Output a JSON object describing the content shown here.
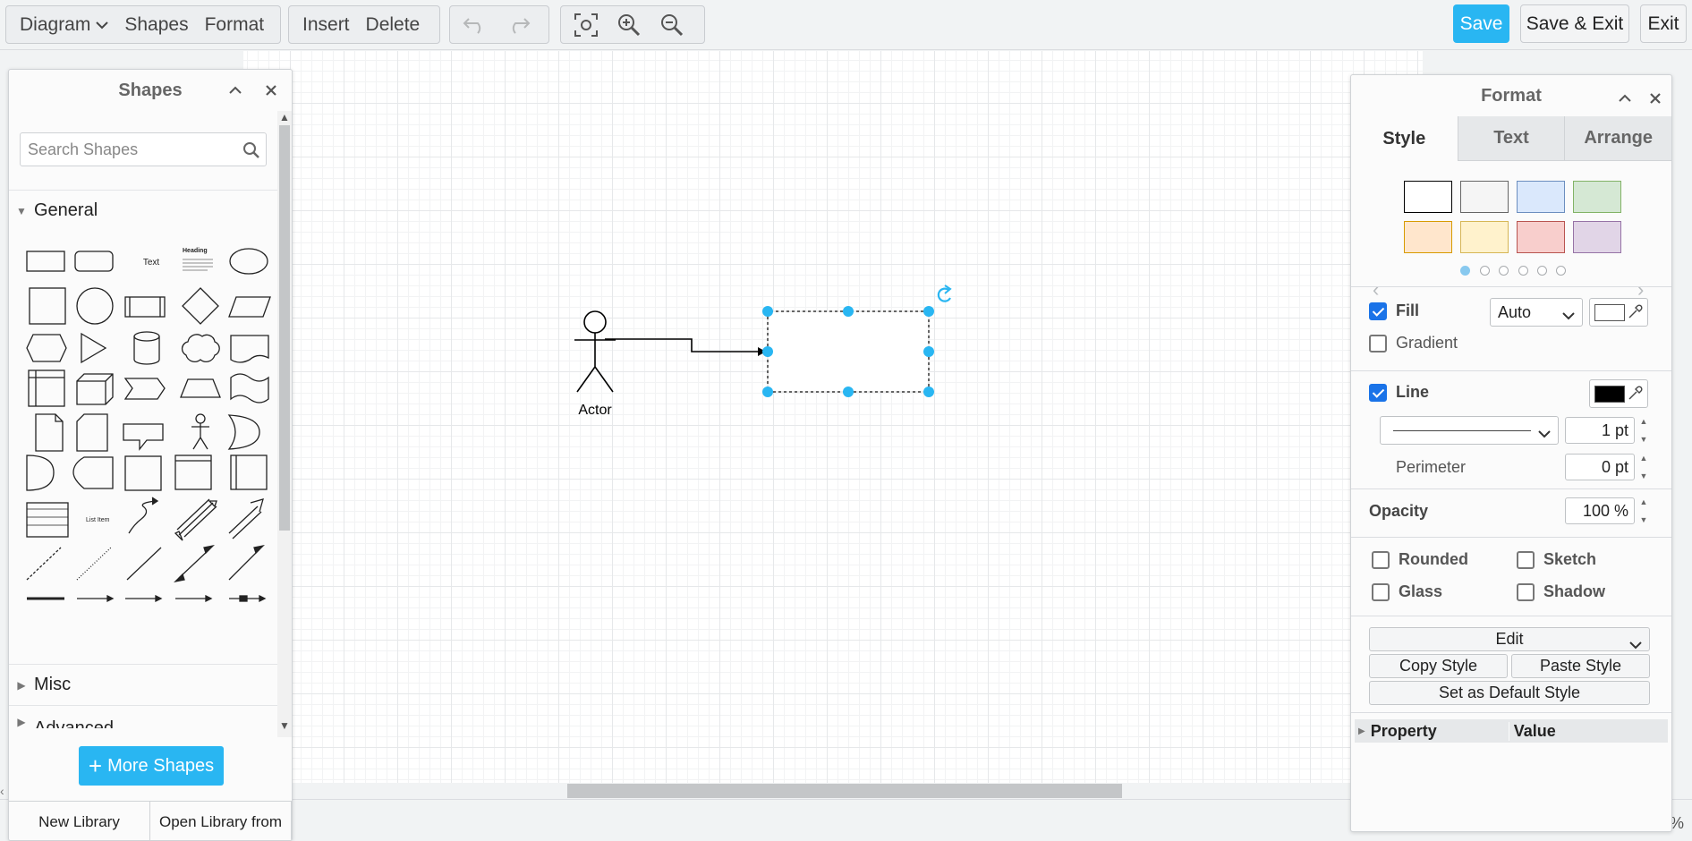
{
  "toolbar": {
    "menus": [
      "Diagram",
      "Shapes",
      "Format"
    ],
    "insert_label": "Insert",
    "delete_label": "Delete",
    "save_label": "Save",
    "save_exit_label": "Save & Exit",
    "exit_label": "Exit"
  },
  "shapes_panel": {
    "title": "Shapes",
    "search_placeholder": "Search Shapes",
    "section_general": "General",
    "section_misc": "Misc",
    "section_advanced": "Advanced",
    "text_shape_label": "Text",
    "heading_shape_label": "Heading",
    "list_item_label": "List Item",
    "more_shapes_label": "More Shapes",
    "new_library_label": "New Library",
    "open_library_label": "Open Library from"
  },
  "diagram": {
    "actor_label": "Actor"
  },
  "format_panel": {
    "title": "Format",
    "tabs": [
      "Style",
      "Text",
      "Arrange"
    ],
    "swatches": [
      {
        "fill": "#ffffff",
        "stroke": "#000000"
      },
      {
        "fill": "#f5f5f5",
        "stroke": "#666666"
      },
      {
        "fill": "#dae8fc",
        "stroke": "#6c8ebf"
      },
      {
        "fill": "#d5e8d4",
        "stroke": "#82b366"
      },
      {
        "fill": "#ffe6cc",
        "stroke": "#d79b00"
      },
      {
        "fill": "#fff2cc",
        "stroke": "#d6b656"
      },
      {
        "fill": "#f8cecc",
        "stroke": "#b85450"
      },
      {
        "fill": "#e1d5e7",
        "stroke": "#9673a6"
      }
    ],
    "fill_label": "Fill",
    "fill_mode": "Auto",
    "fill_color": "#ffffff",
    "gradient_label": "Gradient",
    "line_label": "Line",
    "line_color": "#000000",
    "line_width": "1 pt",
    "perimeter_label": "Perimeter",
    "perimeter_value": "0 pt",
    "opacity_label": "Opacity",
    "opacity_value": "100 %",
    "rounded_label": "Rounded",
    "sketch_label": "Sketch",
    "glass_label": "Glass",
    "shadow_label": "Shadow",
    "edit_label": "Edit",
    "copy_style_label": "Copy Style",
    "paste_style_label": "Paste Style",
    "default_style_label": "Set as Default Style",
    "property_header": "Property",
    "value_header": "Value"
  },
  "status": {
    "zoom_suffix": "%"
  },
  "colors": {
    "accent": "#29b6f2",
    "selection_handle": "#29b6f2",
    "checkbox": "#1a73e8"
  }
}
